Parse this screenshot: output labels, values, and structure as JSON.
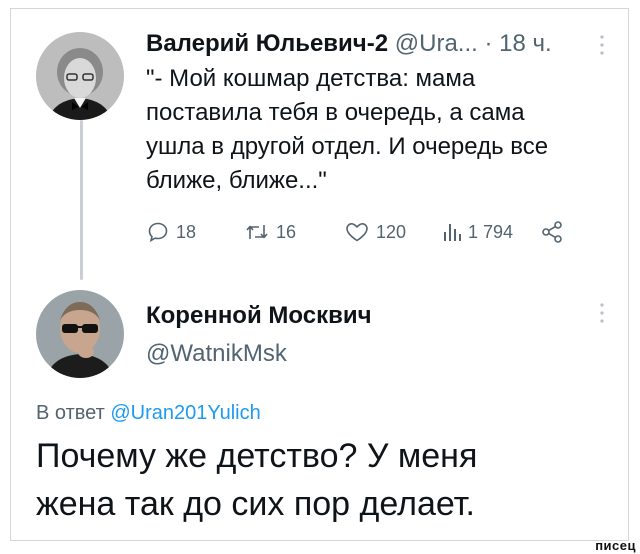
{
  "tweet1": {
    "author_name": "Валерий Юльевич-2",
    "author_handle": "@Ura...",
    "time": "· 18 ч.",
    "text": "\"- Мой кошмар детства: мама\nпоставила тебя в очередь, а сама\nушла в другой отдел. И очередь все\nближе, ближе...\"",
    "actions": {
      "replies": "18",
      "retweets": "16",
      "likes": "120",
      "views": "1 794"
    }
  },
  "tweet2": {
    "author_name": "Коренной Москвич",
    "author_handle": "@WatnikMsk",
    "reply_prefix": "В ответ",
    "reply_mention": "@Uran201Yulich",
    "text": "Почему же детство? У меня\nжена так до сих пор делает."
  },
  "watermark": "писец",
  "icons": {
    "reply": "reply-icon",
    "retweet": "retweet-icon",
    "like": "heart-icon",
    "views": "views-icon",
    "share": "share-icon",
    "more": "more-icon"
  },
  "colors": {
    "text": "#0f1419",
    "secondary": "#536471",
    "link": "#1d9bf0",
    "thread_line": "#c9cfd4"
  }
}
